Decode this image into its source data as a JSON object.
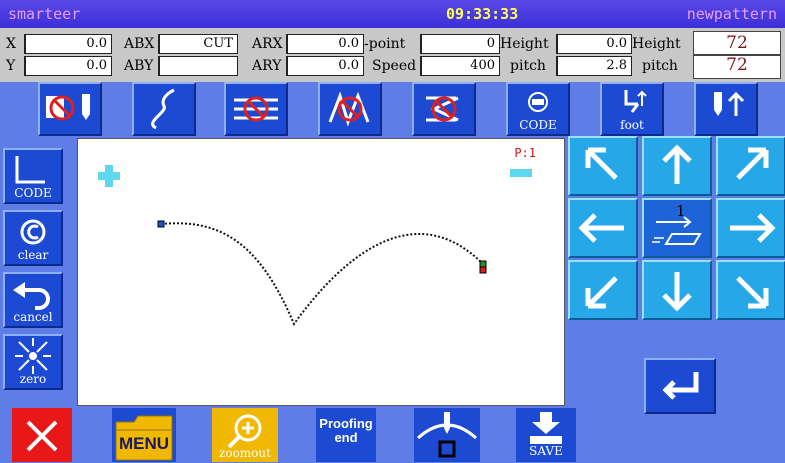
{
  "titlebar": {
    "brand": "smarteer",
    "time": "09:33:33",
    "pattern_name": "newpattern"
  },
  "readout": {
    "x_label": "X",
    "x_value": "0.0",
    "y_label": "Y",
    "y_value": "0.0",
    "abx_label": "ABX",
    "abx_value": "CUT",
    "aby_label": "ABY",
    "aby_value": "",
    "arx_label": "ARX",
    "arx_value": "0.0",
    "ary_label": "ARY",
    "ary_value": "0.0",
    "point_label": "-point",
    "point_value": "0",
    "speed_label": "Speed",
    "speed_value": "400",
    "height_label": "Height",
    "height_value": "0.0",
    "pitch_label": "pitch",
    "pitch_value": "2.8",
    "height2_label": "Height",
    "height2_value": "72",
    "pitch2_label": "pitch",
    "pitch2_value": "72"
  },
  "toolbar": {
    "code_label": "CODE",
    "foot_label": "foot"
  },
  "side": {
    "code_label": "CODE",
    "clear_label": "clear",
    "cancel_label": "cancel",
    "zero_label": "zero"
  },
  "canvas": {
    "page_label": "P:1"
  },
  "arrows": {
    "center_count": "1"
  },
  "bottom": {
    "menu_label": "MENU",
    "zoomout_label": "zoomout",
    "proofing_line1": "Proofing",
    "proofing_line2": "end",
    "save_label": "SAVE"
  },
  "colors": {
    "titlebar": "#3c2fd8",
    "panel": "#c8c8c8",
    "button": "#1c4ad3",
    "arrow_button": "#26a8e8",
    "stitch": "#111111",
    "delete": "#e81818",
    "menu": "#f0b800"
  },
  "icons": [
    "no-thread-icon",
    "curve-icon",
    "no-stitch-icon",
    "no-zigzag-icon",
    "no-back-icon",
    "code-icon",
    "foot-icon",
    "needle-up-icon",
    "enter-icon",
    "close-icon",
    "menu-folder-icon",
    "zoomout-icon",
    "needle-icon",
    "save-icon"
  ]
}
